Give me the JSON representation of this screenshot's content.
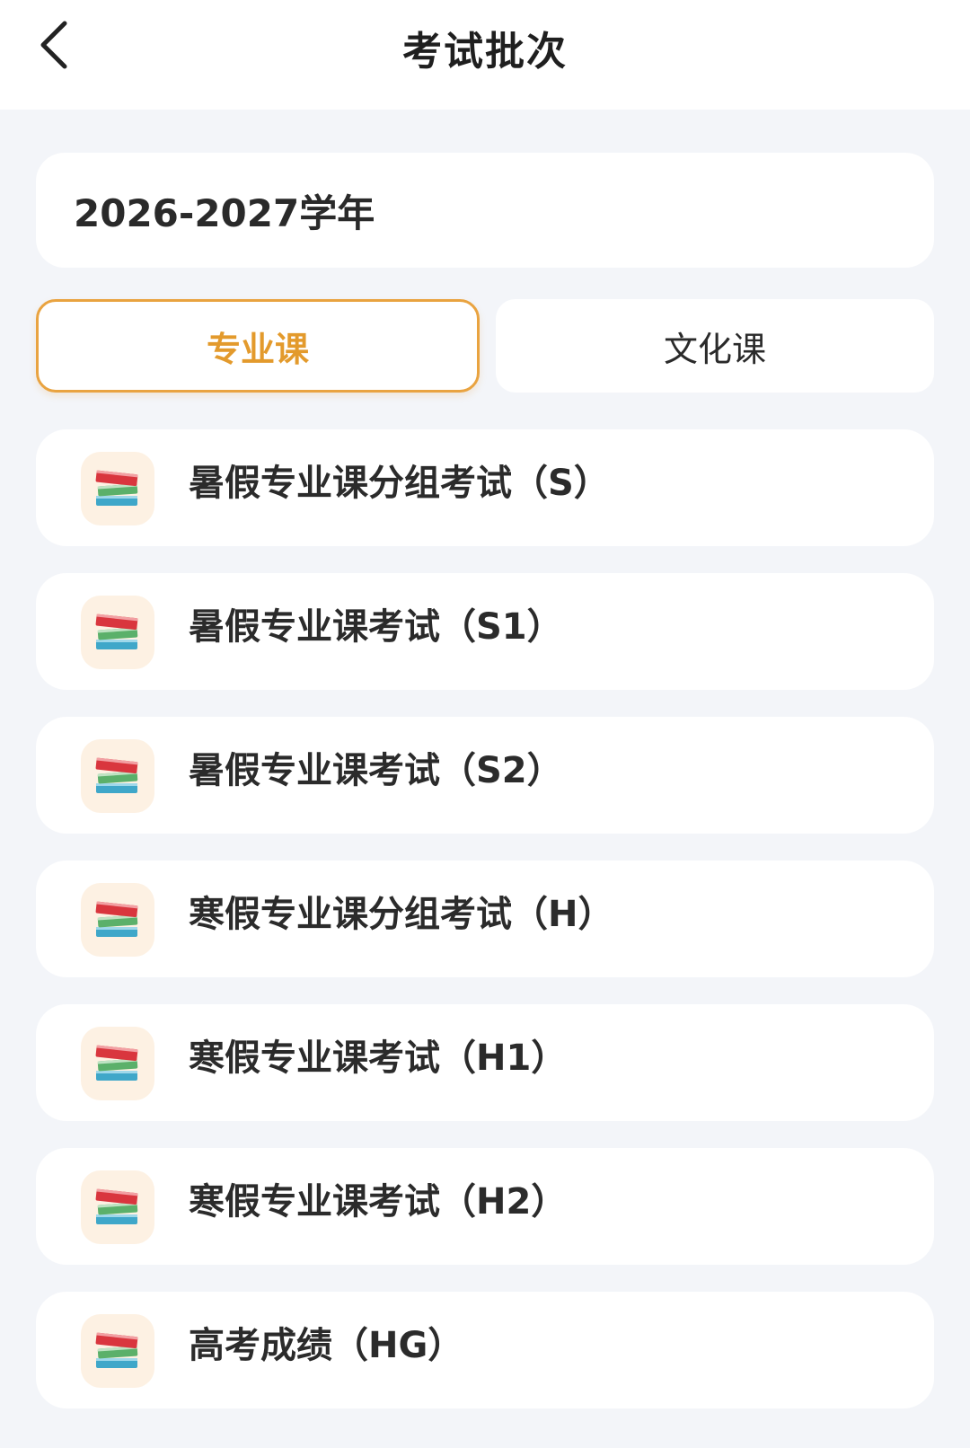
{
  "header": {
    "title": "考试批次",
    "back_icon": "chevron-left-icon"
  },
  "year_selector": {
    "value": "2026-2027学年"
  },
  "tabs": [
    {
      "label": "专业课",
      "selected": true
    },
    {
      "label": "文化课",
      "selected": false
    }
  ],
  "exams": [
    {
      "label": "暑假专业课分组考试（S）",
      "icon": "books-icon"
    },
    {
      "label": "暑假专业课考试（S1）",
      "icon": "books-icon"
    },
    {
      "label": "暑假专业课考试（S2）",
      "icon": "books-icon"
    },
    {
      "label": "寒假专业课分组考试（H）",
      "icon": "books-icon"
    },
    {
      "label": "寒假专业课考试（H1）",
      "icon": "books-icon"
    },
    {
      "label": "寒假专业课考试（H2）",
      "icon": "books-icon"
    },
    {
      "label": "高考成绩（HG）",
      "icon": "books-icon"
    }
  ],
  "colors": {
    "accent": "#e9a340",
    "background": "#f3f5f9",
    "card": "#ffffff"
  }
}
